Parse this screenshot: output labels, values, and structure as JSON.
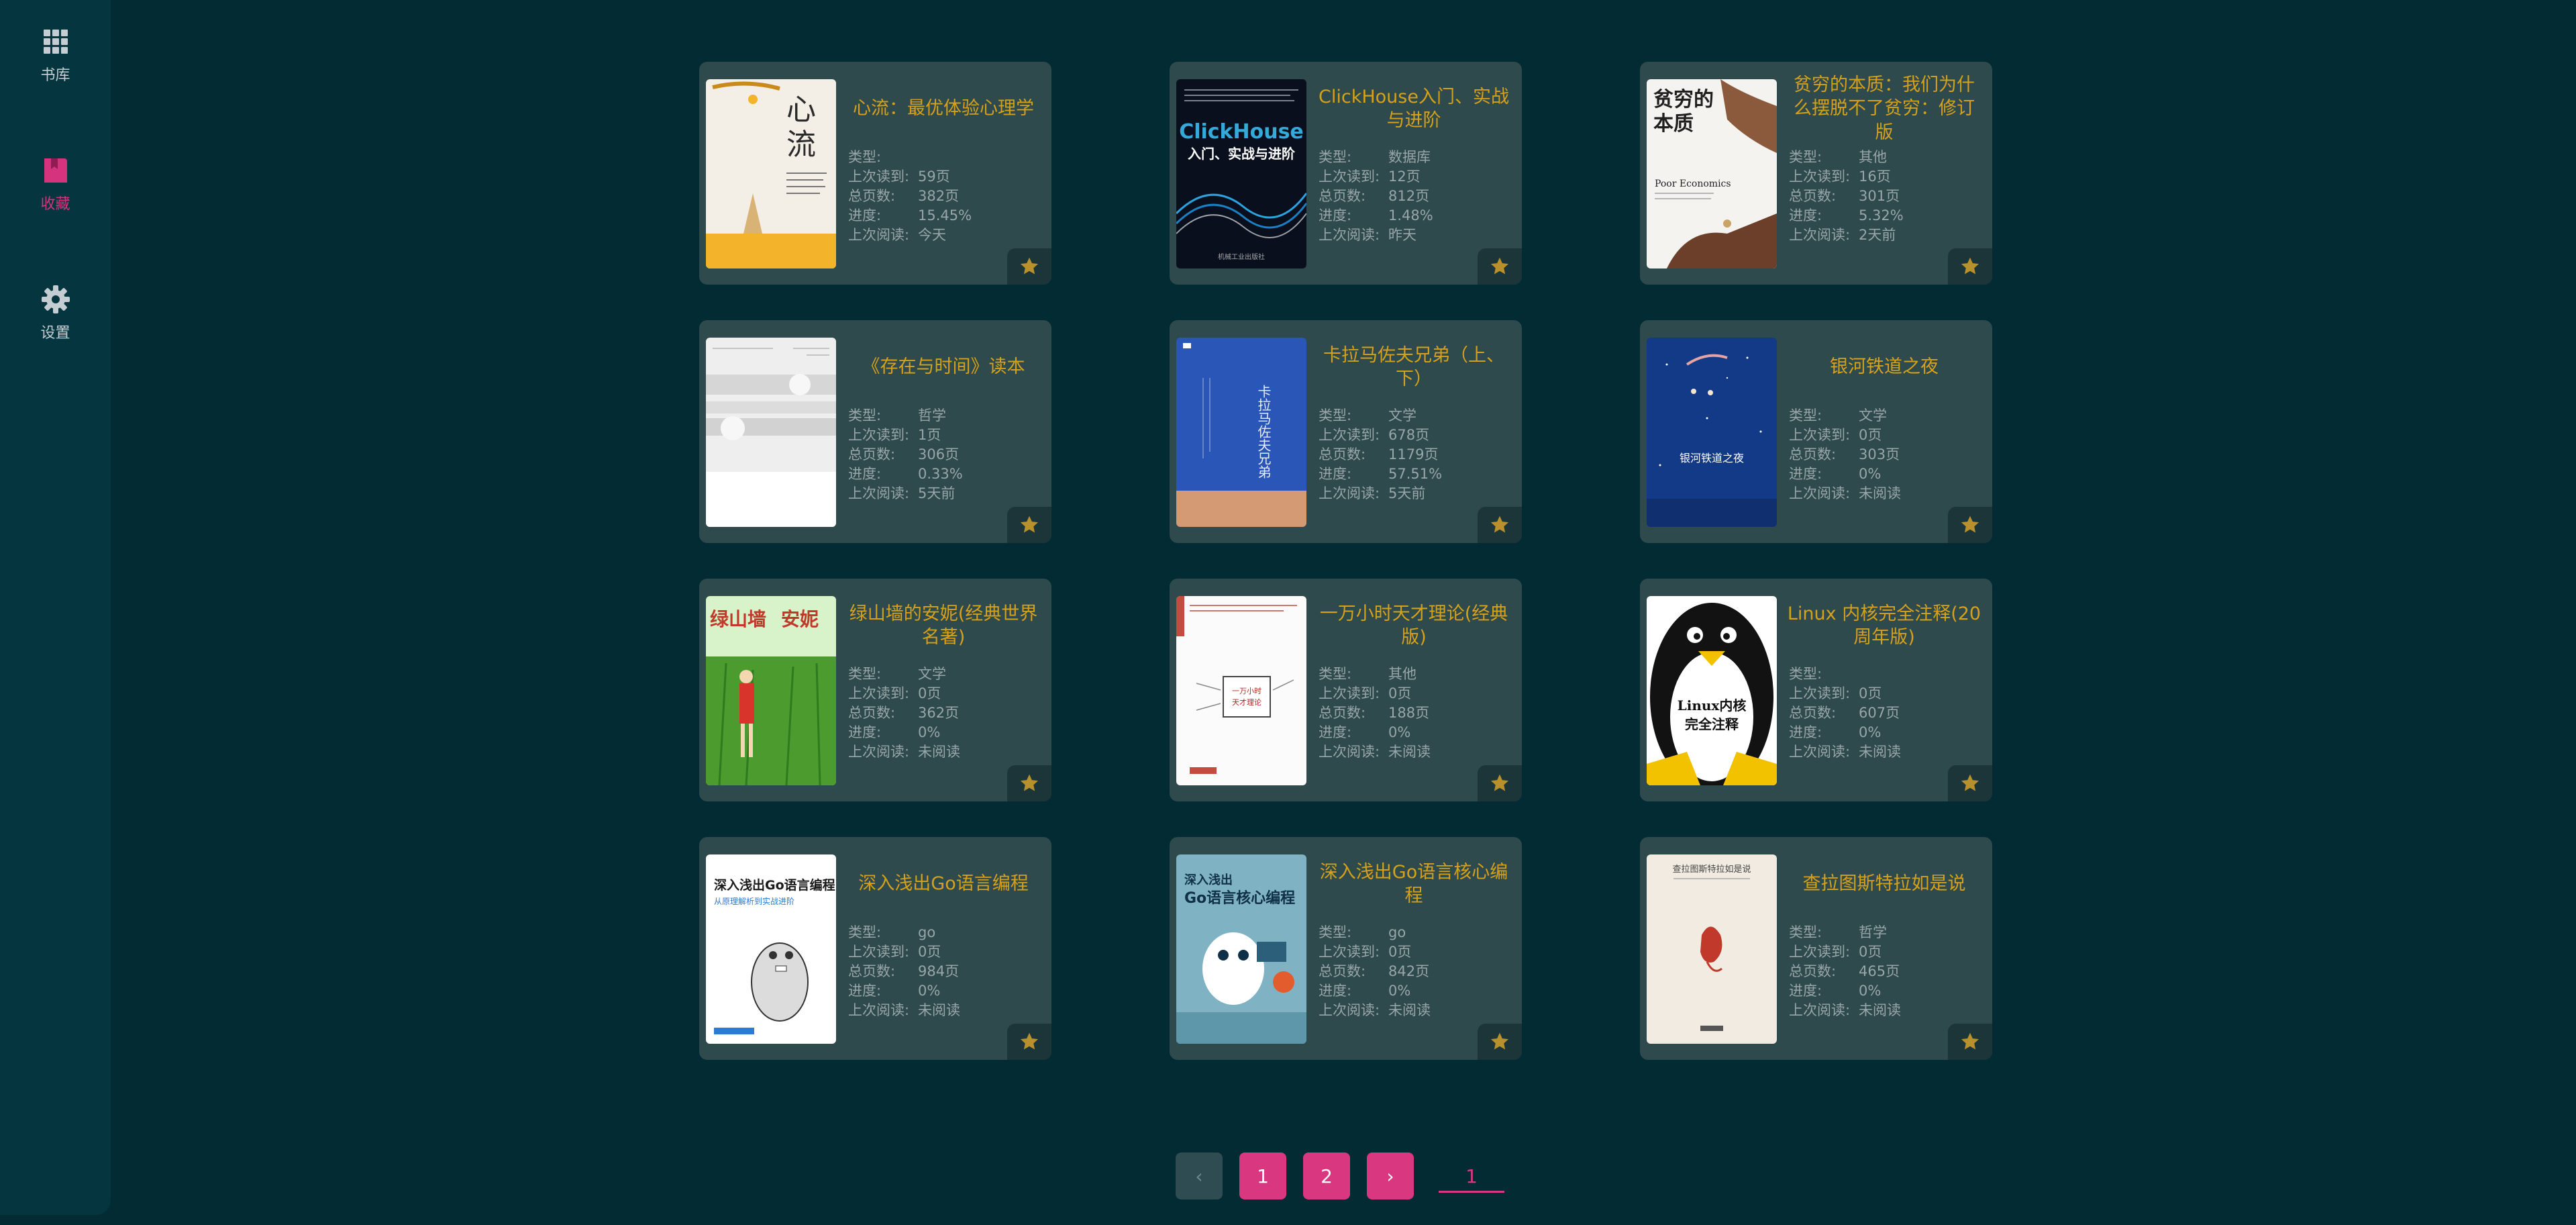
{
  "sidebar": {
    "items": [
      {
        "label": "书库",
        "icon": "grid-icon"
      },
      {
        "label": "收藏",
        "icon": "bookmark-icon"
      },
      {
        "label": "设置",
        "icon": "gear-icon"
      }
    ]
  },
  "colors": {
    "background": "#022b33",
    "card": "#2f4a4c",
    "title": "#d6a11a",
    "accent": "#d93880",
    "star": "#b8902c"
  },
  "labels": {
    "type": "类型:",
    "last_read_page": "上次读到:",
    "total_pages": "总页数:",
    "progress": "进度:",
    "last_read": "上次阅读:"
  },
  "books": [
    {
      "title": "心流：最优体验心理学",
      "type": "",
      "last_page": "59页",
      "pages": "382页",
      "progress": "15.45%",
      "last_read": "今天"
    },
    {
      "title": "ClickHouse入门、实战与进阶",
      "type": "数据库",
      "last_page": "12页",
      "pages": "812页",
      "progress": "1.48%",
      "last_read": "昨天"
    },
    {
      "title": "贫穷的本质：我们为什么摆脱不了贫穷：修订版",
      "type": "其他",
      "last_page": "16页",
      "pages": "301页",
      "progress": "5.32%",
      "last_read": "2天前"
    },
    {
      "title": "《存在与时间》读本",
      "type": "哲学",
      "last_page": "1页",
      "pages": "306页",
      "progress": "0.33%",
      "last_read": "5天前"
    },
    {
      "title": "卡拉马佐夫兄弟（上、下）",
      "type": "文学",
      "last_page": "678页",
      "pages": "1179页",
      "progress": "57.51%",
      "last_read": "5天前"
    },
    {
      "title": "银河铁道之夜",
      "type": "文学",
      "last_page": "0页",
      "pages": "303页",
      "progress": "0%",
      "last_read": "未阅读"
    },
    {
      "title": "绿山墙的安妮(经典世界名著)",
      "type": "文学",
      "last_page": "0页",
      "pages": "362页",
      "progress": "0%",
      "last_read": "未阅读"
    },
    {
      "title": "一万小时天才理论(经典版)",
      "type": "其他",
      "last_page": "0页",
      "pages": "188页",
      "progress": "0%",
      "last_read": "未阅读"
    },
    {
      "title": "Linux 内核完全注释(20周年版)",
      "type": "",
      "last_page": "0页",
      "pages": "607页",
      "progress": "0%",
      "last_read": "未阅读"
    },
    {
      "title": "深入浅出Go语言编程",
      "type": "go",
      "last_page": "0页",
      "pages": "984页",
      "progress": "0%",
      "last_read": "未阅读"
    },
    {
      "title": "深入浅出Go语言核心编程",
      "type": "go",
      "last_page": "0页",
      "pages": "842页",
      "progress": "0%",
      "last_read": "未阅读"
    },
    {
      "title": "查拉图斯特拉如是说",
      "type": "哲学",
      "last_page": "0页",
      "pages": "465页",
      "progress": "0%",
      "last_read": "未阅读"
    }
  ],
  "covers": [
    {
      "text": "心 流",
      "bg": "#f4efe6",
      "fg": "#2b2b2b",
      "accent": "#f3b32a"
    },
    {
      "text": "ClickHouse 入门、实战与进阶",
      "bg": "#0a0f1e",
      "fg": "#ffffff",
      "accent": "#35a9d8"
    },
    {
      "text": "贫穷的 本质 Poor Economics",
      "bg": "#f5f3ef",
      "fg": "#1f1f1f",
      "accent": "#8b5a3c"
    },
    {
      "text": "",
      "bg": "#eeeeee",
      "fg": "#999999",
      "accent": "#cfcfcf"
    },
    {
      "text": "卡拉马佐夫兄弟",
      "bg": "#2a56b7",
      "fg": "#e6ecff",
      "accent": "#d39a74"
    },
    {
      "text": "银河铁道之夜",
      "bg": "#123a86",
      "fg": "#ffffff",
      "accent": "#e7a3a3"
    },
    {
      "text": "绿山墙的安妮",
      "bg": "#d8f2c9",
      "fg": "#c0392b",
      "accent": "#4b9b2f"
    },
    {
      "text": "一万小时 天才理论",
      "bg": "#fbfbfb",
      "fg": "#b3261e",
      "accent": "#c44b3f"
    },
    {
      "text": "Linux内核 完全注释",
      "bg": "#121212",
      "fg": "#121212",
      "accent": "#f2c200"
    },
    {
      "text": "深入浅出Go语言编程 从原理解析到实战进阶",
      "bg": "#ffffff",
      "fg": "#1a1a1a",
      "accent": "#2a7bd4"
    },
    {
      "text": "深入浅出 Go语言核心编程",
      "bg": "#7fb3c4",
      "fg": "#0f3047",
      "accent": "#e35c2e"
    },
    {
      "text": "查拉图斯特拉如是说",
      "bg": "#f1ebe1",
      "fg": "#444444",
      "accent": "#c0392b"
    }
  ],
  "pagination": {
    "prev": "‹",
    "next": "›",
    "pages": [
      "1",
      "2"
    ],
    "current": "1"
  }
}
